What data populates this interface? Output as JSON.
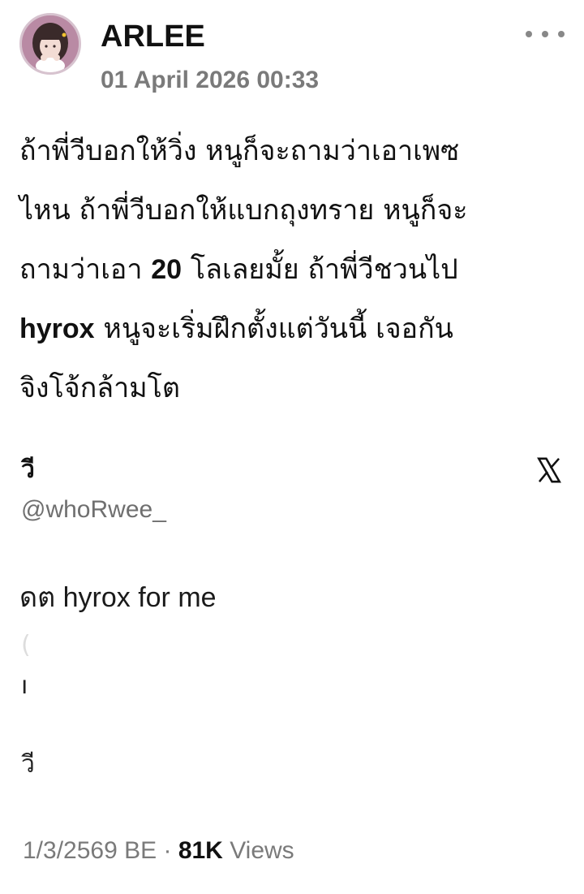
{
  "post": {
    "author": "ARLEE",
    "timestamp": "01 April 2026 00:33",
    "body": {
      "line1": "ถ้าพี่วีบอกให้วิ่ง หนูก็จะถามว่าเอาเพซ",
      "line2": "ไหน ถ้าพี่วีบอกให้แบกถุงทราย หนูก็จะ",
      "line3_pre": "ถามว่าเอา ",
      "line3_bold": "20",
      "line3_post": " โลเลยมั้ย ถ้าพี่วีชวนไป",
      "line4_bold": "hyrox",
      "line4_post": " หนูจะเริ่มฝึกตั้งแต่วันนี้ เจอกัน",
      "line5": "จิงโจ้กล้ามโต"
    }
  },
  "quote": {
    "name_fragment": "วี",
    "handle": "@whoRwee_",
    "text": "ดต hyrox for me",
    "frag1": "(",
    "frag2": "ı",
    "frag3": "วี"
  },
  "meta": {
    "date": "1/3/2569 BE",
    "separator": " · ",
    "views_count": "81K",
    "views_label": " Views"
  },
  "icons": {
    "more": "more-horizontal-icon",
    "platform": "x-logo-icon"
  },
  "colors": {
    "secondary_text": "#7a7a7a",
    "primary_text": "#111111",
    "background": "#ffffff"
  }
}
